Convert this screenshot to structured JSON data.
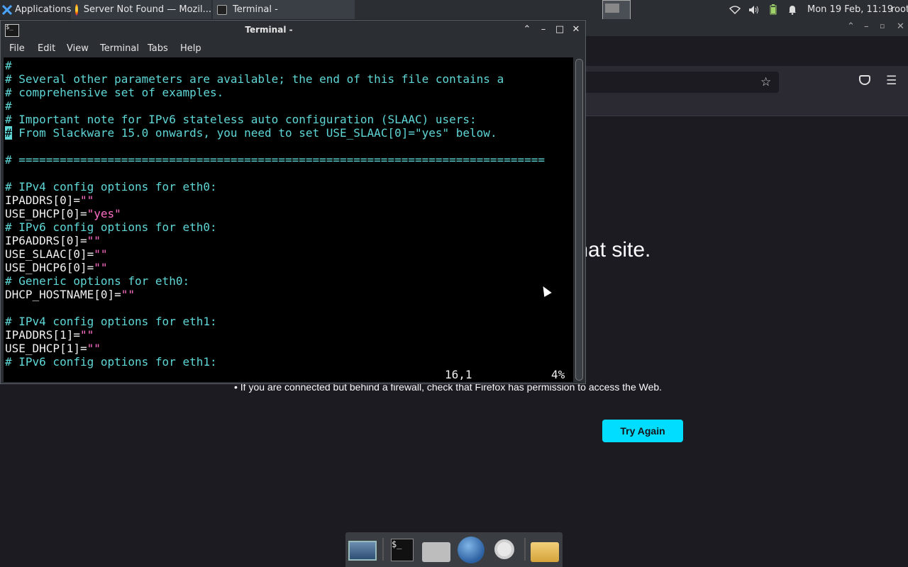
{
  "panel": {
    "applications_label": "Applications",
    "tasks": [
      {
        "label": "Server Not Found — Mozil..."
      },
      {
        "label": "Terminal -"
      }
    ],
    "clock": "Mon 19 Feb, 11:19",
    "user": "root"
  },
  "firefox": {
    "heading_fragment": "that site.",
    "bullet_text": "• If you are connected but behind a firewall, check that Firefox has permission to access the Web.",
    "try_again_label": "Try Again"
  },
  "terminal": {
    "title": "Terminal -",
    "menu": [
      "File",
      "Edit",
      "View",
      "Terminal",
      "Tabs",
      "Help"
    ],
    "lines": [
      {
        "text": "#",
        "style": "comment"
      },
      {
        "text": "# Several other parameters are available; the end of this file contains a",
        "style": "comment"
      },
      {
        "text": "# comprehensive set of examples.",
        "style": "comment"
      },
      {
        "text": "#",
        "style": "comment"
      },
      {
        "text": "# Important note for IPv6 stateless auto configuration (SLAAC) users:",
        "style": "comment"
      },
      {
        "text": "# From Slackware 15.0 onwards, you need to set USE_SLAAC[0]=\"yes\" below.",
        "style": "cursor-comment"
      },
      {
        "text": "",
        "style": "plain"
      },
      {
        "text": "# =============================================================================",
        "style": "comment"
      },
      {
        "text": "",
        "style": "plain"
      },
      {
        "text": "# IPv4 config options for eth0:",
        "style": "comment"
      },
      {
        "text": "IPADDRS[0]=\"\"",
        "style": "assign"
      },
      {
        "text": "USE_DHCP[0]=\"yes\"",
        "style": "assign"
      },
      {
        "text": "# IPv6 config options for eth0:",
        "style": "comment"
      },
      {
        "text": "IP6ADDRS[0]=\"\"",
        "style": "assign"
      },
      {
        "text": "USE_SLAAC[0]=\"\"",
        "style": "assign"
      },
      {
        "text": "USE_DHCP6[0]=\"\"",
        "style": "assign"
      },
      {
        "text": "# Generic options for eth0:",
        "style": "comment"
      },
      {
        "text": "DHCP_HOSTNAME[0]=\"\"",
        "style": "assign"
      },
      {
        "text": "",
        "style": "plain"
      },
      {
        "text": "# IPv4 config options for eth1:",
        "style": "comment"
      },
      {
        "text": "IPADDRS[1]=\"\"",
        "style": "assign"
      },
      {
        "text": "USE_DHCP[1]=\"\"",
        "style": "assign"
      },
      {
        "text": "# IPv6 config options for eth1:",
        "style": "comment"
      }
    ],
    "status_position": "16,1",
    "status_percent": "4%"
  },
  "icons": {
    "panel_tray": [
      "wifi-icon",
      "volume-icon",
      "battery-icon",
      "bell-icon"
    ],
    "dock": [
      "desktop-icon",
      "terminal-icon",
      "home-folder-icon",
      "web-browser-icon",
      "search-icon",
      "folder-icon"
    ]
  }
}
